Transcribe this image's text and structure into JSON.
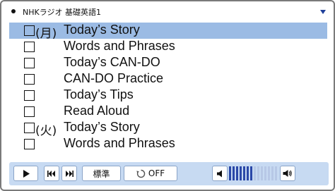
{
  "header": {
    "title": "NHKラジオ 基礎英語1",
    "bullet_icon": "bullet-dot-icon",
    "dropdown_icon": "triangle-down-icon",
    "dropdown_color": "#1f3f9a"
  },
  "list": {
    "selected_color": "#9bbbe4",
    "items": [
      {
        "day": "(月)",
        "label": "Today’s Story",
        "selected": true
      },
      {
        "day": "",
        "label": "Words and Phrases",
        "selected": false
      },
      {
        "day": "",
        "label": "Today’s CAN-DO",
        "selected": false
      },
      {
        "day": "",
        "label": "CAN-DO Practice",
        "selected": false
      },
      {
        "day": "",
        "label": "Today’s Tips",
        "selected": false
      },
      {
        "day": "",
        "label": "Read Aloud",
        "selected": false
      },
      {
        "day": "(火)",
        "label": "Today’s Story",
        "selected": false
      },
      {
        "day": "",
        "label": "Words and Phrases",
        "selected": false
      }
    ]
  },
  "controls": {
    "bar_color": "#c7daf2",
    "play_icon": "play-icon",
    "prev_icon": "skip-previous-icon",
    "next_icon": "skip-next-icon",
    "speed_label": "標準",
    "repeat_icon": "repeat-icon",
    "repeat_label": "OFF",
    "volume_down_icon": "volume-down-icon",
    "volume_up_icon": "volume-up-icon",
    "volume_level": 0.5,
    "volume_active_color": "#2a48a8",
    "volume_inactive_color": "#b7c8e6"
  }
}
